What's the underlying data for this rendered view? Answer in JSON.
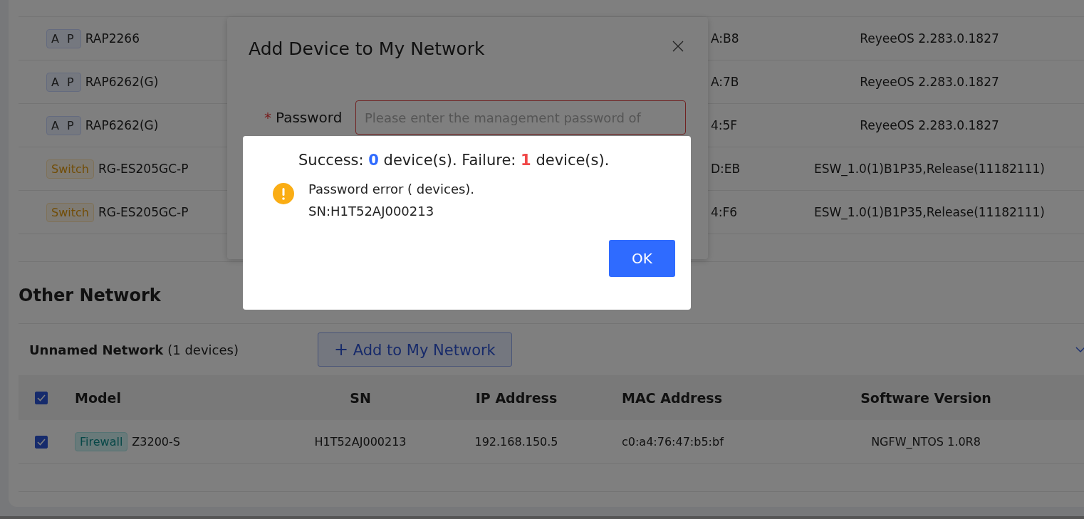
{
  "my_network_table": {
    "rows": [
      {
        "kind": "ap",
        "tag": "A P",
        "model": "RAP2266",
        "mac_address": "A:B8",
        "software_version": "ReyeeOS 2.283.0.1827"
      },
      {
        "kind": "ap",
        "tag": "A P",
        "model": "RAP6262(G)",
        "mac_address": "A:7B",
        "software_version": "ReyeeOS 2.283.0.1827"
      },
      {
        "kind": "ap",
        "tag": "A P",
        "model": "RAP6262(G)",
        "mac_address": "4:5F",
        "software_version": "ReyeeOS 2.283.0.1827"
      },
      {
        "kind": "switch",
        "tag": "Switch",
        "model": "RG-ES205GC-P",
        "mac_address": "D:EB",
        "software_version": "ESW_1.0(1)B1P35,Release(11182111)"
      },
      {
        "kind": "switch",
        "tag": "Switch",
        "model": "RG-ES205GC-P",
        "mac_address": "4:F6",
        "software_version": "ESW_1.0(1)B1P35,Release(11182111)"
      }
    ]
  },
  "other_network": {
    "title": "Other Network",
    "network_name": "Unnamed Network",
    "device_count": "(1 devices)",
    "add_button": {
      "icon": "+",
      "label": "Add to My Network"
    },
    "table": {
      "header_checked": true,
      "columns": [
        "Model",
        "SN",
        "IP Address",
        "MAC Address",
        "Software Version"
      ],
      "rows": [
        {
          "checked": true,
          "kind": "firewall",
          "tag": "Firewall",
          "model": "Z3200-S",
          "sn": "H1T52AJ000213",
          "ip_address": "192.168.150.5",
          "mac_address": "c0:a4:76:47:b5:bf",
          "software_version": "NGFW_NTOS 1.0R8"
        }
      ]
    }
  },
  "add_device_dialog": {
    "title": "Add Device to My Network",
    "required_mark": "*",
    "password_label": "Password",
    "password_placeholder": "Please enter the management password of"
  },
  "result_dialog": {
    "success_label": "Success:",
    "success_count": "0",
    "success_unit": "device(s).",
    "failure_label": "Failure:",
    "failure_count": "1",
    "failure_unit": "device(s).",
    "message": "Password error ( devices).",
    "sn_line": "SN:H1T52AJ000213",
    "ok_button": "OK"
  }
}
